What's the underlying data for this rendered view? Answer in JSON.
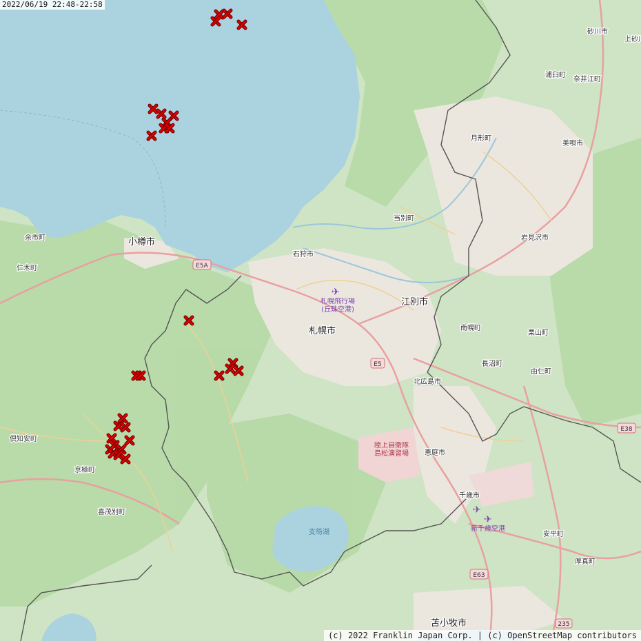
{
  "timestamp": "2022/06/19 22:48-22:58",
  "attribution": "(c) 2022 Franklin Japan Corp. | (c) OpenStreetMap contributors",
  "colors": {
    "sea": "#aad3df",
    "land": "#cfe4c4",
    "forest": "#aed4a0",
    "urban": "#e8e4dc",
    "road_major": "#e88a8a",
    "road_minor": "#f0c27a",
    "boundary": "#555555",
    "marker": "#e00000"
  },
  "marker_icon": "red-x-lightning-strike-icon",
  "places": {
    "sapporo": "札幌市",
    "otaru": "小樽市",
    "ishikari": "石狩市",
    "ebetsu": "江別市",
    "kitahiroshima": "北広島市",
    "eniwa": "恵庭市",
    "chitose": "千歳市",
    "tomakomai": "苫小牧市",
    "iwamizawa": "岩見沢市",
    "bibai": "美唄市",
    "sunagawa": "砂川市",
    "kamisunagawa": "上砂川",
    "urausu": "浦臼町",
    "naie": "奈井江町",
    "tsukigata": "月形町",
    "tobetsu": "当別町",
    "nanporo": "南幌町",
    "kuriyama": "栗山町",
    "naganuma": "長沼町",
    "yuni": "由仁町",
    "abira": "安平町",
    "atsuma": "厚真町",
    "yoichi": "余市町",
    "niki": "仁木町",
    "kutchan": "倶知安町",
    "kyogoku": "京極町",
    "kimobetsu": "喜茂別町",
    "shikotsu_lake": "支笏湖",
    "okadama_airport": "札幌飛行場(丘珠空港)",
    "new_chitose_airport": "新千歳空港",
    "jgsdf_area": "陸上自衛隊島松演習場"
  },
  "road_shields": [
    "E5A",
    "E5",
    "E38",
    "E63",
    "235"
  ]
}
